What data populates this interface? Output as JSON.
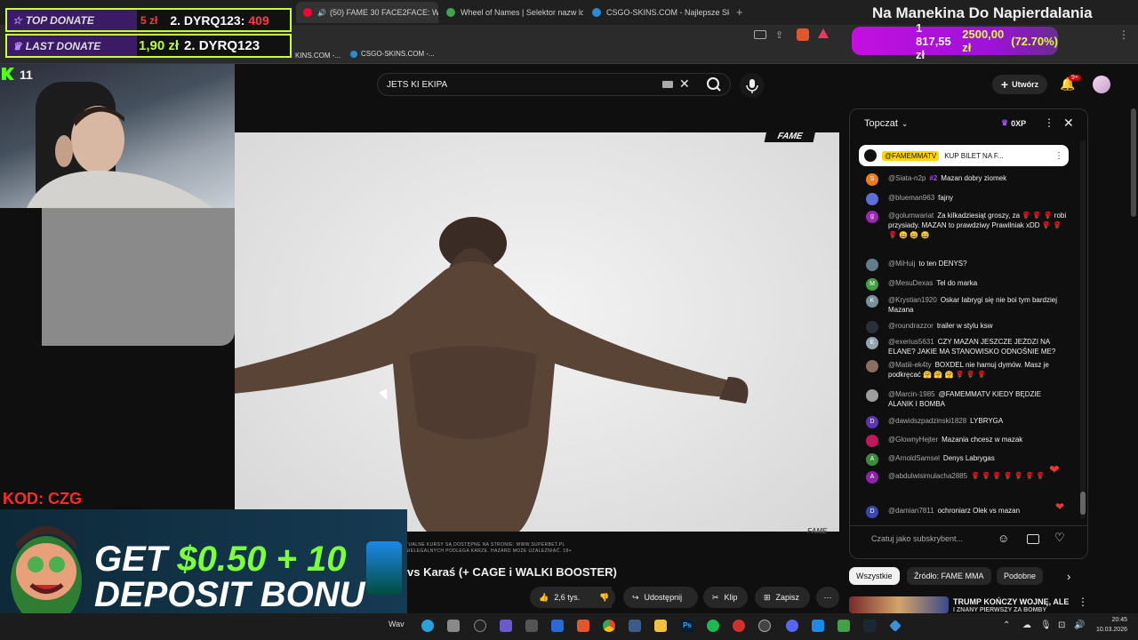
{
  "browser": {
    "tabs": [
      {
        "title": "(50) FAME 30 FACE2FACE: Wa",
        "active": true,
        "fav_color": "#ff0033"
      },
      {
        "title": "Wheel of Names | Selektor nazw losu",
        "active": false,
        "fav_color": "#3fa34d"
      },
      {
        "title": "CSGO-SKINS.COM - Najlepsze Skrzy",
        "active": false,
        "fav_color": "#2b8ad6"
      }
    ],
    "new_tab_icon": "plus-icon",
    "bookmarks": [
      "KINS.COM -...",
      "CSGO-SKINS.COM -..."
    ]
  },
  "stream_overlay": {
    "top_donate_label": "TOP DONATE",
    "top_donate_amount": "5 zł",
    "top_donate_user": "2. DYRQ123:",
    "top_donate_value": "409",
    "last_donate_label": "LAST DONATE",
    "last_donate_amount": "1,90 zł",
    "last_donate_user": "2. DYRQ123",
    "kick_icon": "kick-logo-icon",
    "viewer_count": "11",
    "stream_title": "Na Manekina Do Napierdalania",
    "goal_current": "1 817,55 zł",
    "goal_target": "2500,00 zł",
    "goal_percent": "(72.70%)",
    "promo_code": "KOD: CZG",
    "ad_line1_a": "GET ",
    "ad_line1_b": "$0.50 + 10",
    "ad_line2": "DEPOSIT BONU"
  },
  "youtube": {
    "search_value": "JETS KI EKIPA",
    "create_label": "Utwórz",
    "notifications_badge": "9+",
    "video_watermark": "FAME",
    "video_corner_logo": "FAME",
    "disclaimer_line1": "TUALNE KURSY SĄ DOSTĘPNE NA STRONIE: WWW.SUPERBET.PL",
    "disclaimer_line2": "NIELEGALNYCH PODLEGA KARZE. HAZARD MOŻE UZALEŻNIAĆ. 18+",
    "video_title": "vs Karaś (+ CAGE i WALKI BOOSTER)",
    "likes": "2,6 tys.",
    "share_label": "Udostępnij",
    "clip_label": "Klip",
    "save_label": "Zapisz",
    "chips": [
      "Wszystkie",
      "Źródło: FAME MMA",
      "Podobne"
    ],
    "recommended_title": "TRUMP KOŃCZY WOJNĘ, ALE",
    "recommended_sub": "I ZNANY PIERWSZY ZA BOMBY"
  },
  "chat": {
    "header_label": "Topczat",
    "points": "0XP",
    "pinned_user": "@FAMEMMATV",
    "pinned_text": "KUP BILET NA F...",
    "input_placeholder": "Czatuj jako subskrybent...",
    "messages": [
      {
        "initial": "S",
        "color": "#e67e22",
        "user": "@Siata-n2p",
        "badge": "#2",
        "text": "Mazan dobry ziomek"
      },
      {
        "initial": "",
        "color": "#5b6fd6",
        "user": "@blueman963",
        "badge": "",
        "text": "fajny"
      },
      {
        "initial": "g",
        "color": "#9c27b0",
        "user": "@golumwariat",
        "badge": "",
        "text": "Za kilkadziesiąt groszy, za 🌹 🌹 🌹 robi przysiady. MAZAN to prawdziwy Prawilniak xDD 🌹 🌹 🌹 😄 😄 😄"
      },
      {
        "initial": "",
        "color": "#607d8b",
        "user": "@MiHuij",
        "badge": "",
        "text": "to ten DENYS?"
      },
      {
        "initial": "M",
        "color": "#43a047",
        "user": "@MesuDexas",
        "badge": "",
        "text": "Tel do marka"
      },
      {
        "initial": "K",
        "color": "#78909c",
        "user": "@Krystian1920",
        "badge": "",
        "text": "Oskar Iabrygi się nie boi tym bardziej Mazana"
      },
      {
        "initial": "",
        "color": "#263238",
        "user": "@roundrazzor",
        "badge": "",
        "text": "trailer w stylu ksw"
      },
      {
        "initial": "E",
        "color": "#90a4ae",
        "user": "@exerius5631",
        "badge": "",
        "text": "CZY MAZAN JESZCZE JEŻDZI NA ELANE? JAKIE MA STANOWISKO ODNOŚNIE ME?"
      },
      {
        "initial": "",
        "color": "#8d6e63",
        "user": "@Matiii-ek4ty",
        "badge": "",
        "text": "BOXDEL nie hamuj dymów. Masz je podkręcać 🤗 🤗 🤗 🌹 🌹 🌹"
      },
      {
        "initial": "",
        "color": "#9e9e9e",
        "user": "@Marcin-1985",
        "badge": "",
        "text": "@FAMEMMATV KIEDY BĘDZIE ALANIK I BOMBA"
      },
      {
        "initial": "D",
        "color": "#5e35b1",
        "user": "@dawidszpadzinski1828",
        "badge": "",
        "text": "LYBRYGA"
      },
      {
        "initial": "",
        "color": "#c2185b",
        "user": "@GlownyHejter",
        "badge": "",
        "text": "Mazania chcesz w mazak"
      },
      {
        "initial": "A",
        "color": "#388e3c",
        "user": "@ArnoldSamsel",
        "badge": "",
        "text": "Denys Labrygas"
      },
      {
        "initial": "A",
        "color": "#8e24aa",
        "user": "@abdulwisimulacha2885",
        "badge": "",
        "text": "🌹 🌹 🌹 🌹 🌹 🌹 🌹"
      },
      {
        "initial": "D",
        "color": "#3949ab",
        "user": "@damian7811",
        "badge": "",
        "text": "ochroniarz Olek vs mazan"
      }
    ]
  },
  "taskbar": {
    "time": "20:45",
    "date": "10.03.2026"
  }
}
